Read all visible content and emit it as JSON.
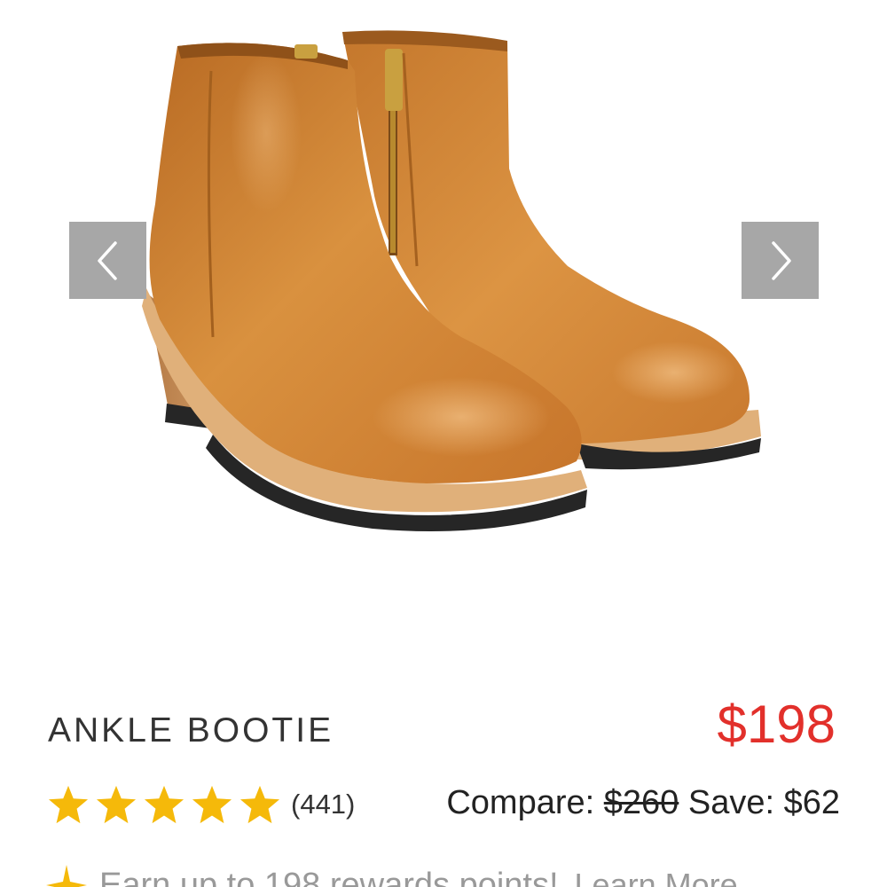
{
  "product": {
    "title": "ANKLE BOOTIE",
    "price": "$198",
    "rating": {
      "stars": 5,
      "review_count": "(441)"
    },
    "compare": {
      "label": "Compare:",
      "original_price": "$260",
      "save_label": "Save: $62"
    },
    "rewards": {
      "text": "Earn up to 198 rewards points!",
      "link": "Learn More"
    }
  },
  "gallery": {
    "prev_icon": "chevron-left-icon",
    "next_icon": "chevron-right-icon",
    "image": "ankle-bootie-pair-photo"
  },
  "colors": {
    "price": "#e2302b",
    "star": "#f5b90a",
    "arrow_bg": "#a7a7a7",
    "leather": "#d58a3a"
  }
}
